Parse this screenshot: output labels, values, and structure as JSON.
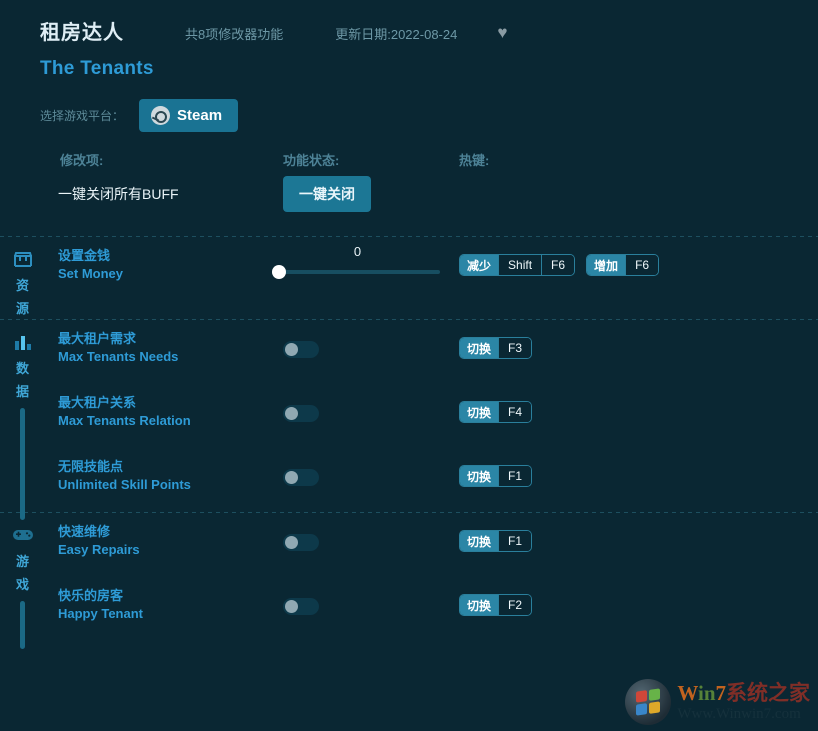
{
  "header": {
    "title_cn": "租房达人",
    "title_en": "The Tenants",
    "features_count": "共8项修改器功能",
    "update_date": "更新日期:2022-08-24",
    "favorite_icon": "♥"
  },
  "platform": {
    "label": "选择游戏平台：",
    "selected": "Steam"
  },
  "columns": {
    "option": "修改项:",
    "status": "功能状态:",
    "hotkey": "热键:"
  },
  "master": {
    "label": "一键关闭所有BUFF",
    "button": "一键关闭"
  },
  "sections": [
    {
      "name_cn": "资源",
      "icon": "chest-icon",
      "rows": [
        {
          "cn": "设置金钱",
          "en": "Set Money",
          "control": "slider",
          "value": "0",
          "slider_percent": 0,
          "hotkeys": [
            {
              "action": "减少",
              "keys": [
                "Shift",
                "F6"
              ]
            },
            {
              "action": "增加",
              "keys": [
                "F6"
              ]
            }
          ]
        }
      ]
    },
    {
      "name_cn": "数据",
      "icon": "bar-chart-icon",
      "rows": [
        {
          "cn": "最大租户需求",
          "en": "Max Tenants Needs",
          "control": "toggle",
          "on": false,
          "hotkeys": [
            {
              "action": "切换",
              "keys": [
                "F3"
              ]
            }
          ]
        },
        {
          "cn": "最大租户关系",
          "en": "Max Tenants Relation",
          "control": "toggle",
          "on": false,
          "hotkeys": [
            {
              "action": "切换",
              "keys": [
                "F4"
              ]
            }
          ]
        },
        {
          "cn": "无限技能点",
          "en": "Unlimited Skill Points",
          "control": "toggle",
          "on": false,
          "hotkeys": [
            {
              "action": "切换",
              "keys": [
                "F1"
              ]
            }
          ]
        }
      ]
    },
    {
      "name_cn": "游戏",
      "icon": "gamepad-icon",
      "rows": [
        {
          "cn": "快速维修",
          "en": "Easy Repairs",
          "control": "toggle",
          "on": false,
          "hotkeys": [
            {
              "action": "切换",
              "keys": [
                "F1"
              ]
            }
          ]
        },
        {
          "cn": "快乐的房客",
          "en": "Happy Tenant",
          "control": "toggle",
          "on": false,
          "hotkeys": [
            {
              "action": "切换",
              "keys": [
                "F2"
              ]
            }
          ]
        }
      ]
    }
  ],
  "watermark": {
    "win": "W",
    "in": "in",
    "seven": "7",
    "suffix": "系统之家",
    "url": "Www.Winwin7.com"
  },
  "colors": {
    "background": "#0a2733",
    "accent": "#2e9bd6",
    "button": "#1c7795",
    "steam": "#1a7393"
  }
}
